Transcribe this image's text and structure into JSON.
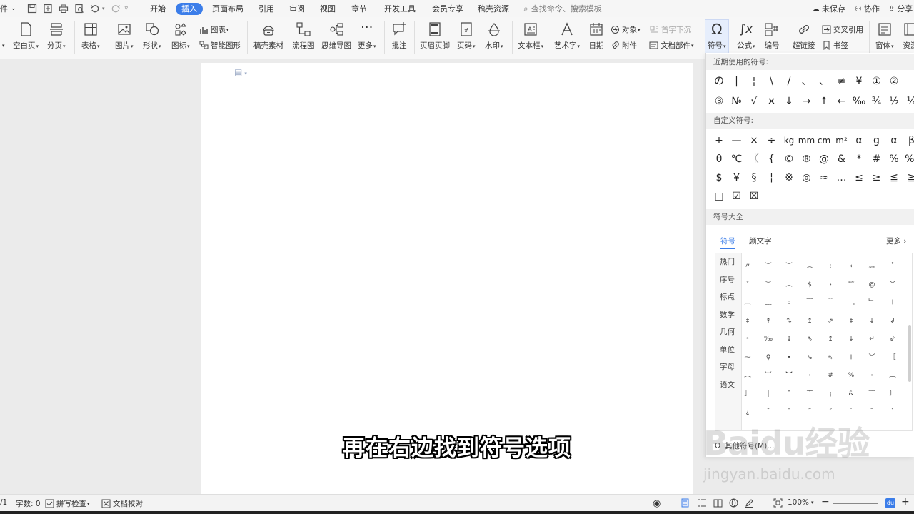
{
  "menubar": {
    "file_fragment": "件",
    "tabs": [
      {
        "label": "开始",
        "active": false
      },
      {
        "label": "插入",
        "active": true
      },
      {
        "label": "页面布局",
        "active": false
      },
      {
        "label": "引用",
        "active": false
      },
      {
        "label": "审阅",
        "active": false
      },
      {
        "label": "视图",
        "active": false
      },
      {
        "label": "章节",
        "active": false
      },
      {
        "label": "开发工具",
        "active": false
      },
      {
        "label": "会员专享",
        "active": false
      },
      {
        "label": "稿壳资源",
        "active": false
      }
    ],
    "search_placeholder": "查找命令、搜索模板",
    "unsaved": "未保存",
    "collaborate": "协作",
    "share": "分享"
  },
  "ribbon": {
    "blank_page": "空白页",
    "page_break": "分页",
    "table": "表格",
    "picture": "图片",
    "shape": "形状",
    "icon": "图标",
    "chart": "图表",
    "smart_art": "智能图形",
    "gaoke_material": "稿壳素材",
    "flowchart": "流程图",
    "mindmap": "思维导图",
    "more": "更多",
    "comment": "批注",
    "header_footer": "页眉页脚",
    "page_number": "页码",
    "watermark": "水印",
    "textbox": "文本框",
    "wordart": "艺术字",
    "date": "日期",
    "object": "对象",
    "attachment": "附件",
    "drop_cap": "首字下沉",
    "doc_parts": "文档部件",
    "symbol": "符号",
    "formula": "公式",
    "numbering": "编号",
    "cross_ref": "交叉引用",
    "hyperlink": "超链接",
    "bookmark": "书签",
    "font_style": "窗体",
    "resources": "资源"
  },
  "panel": {
    "recent_title": "近期使用的符号:",
    "recent_symbols": [
      "の",
      "|",
      "¦",
      "\\",
      "/",
      "、",
      "、",
      "≠",
      "¥",
      "①",
      "②",
      "③",
      "№",
      "√",
      "×",
      "↓",
      "→",
      "↑",
      "←",
      "‰",
      "¾",
      "½",
      "¼"
    ],
    "custom_title": "自定义符号:",
    "custom_symbols": [
      "+",
      "—",
      "×",
      "÷",
      "kg",
      "mm",
      "cm",
      "m²",
      "α",
      "g",
      "α",
      "β",
      "θ",
      "℃",
      "〖",
      "{",
      "©",
      "®",
      "@",
      "&",
      "*",
      "#",
      "%",
      "‰",
      "$",
      "￥",
      "§",
      "¦",
      "※",
      "◎",
      "≈",
      "…",
      "≤",
      "≥",
      "≦",
      "≧",
      "□",
      "☑",
      "☒"
    ],
    "all_title": "符号大全",
    "tab_symbol": "符号",
    "tab_kaomoji": "颜文字",
    "more_link": "更多",
    "categories": [
      "热门",
      "序号",
      "标点",
      "数学",
      "几何",
      "单位",
      "字母",
      "语文"
    ],
    "grid_symbols": [
      "〃",
      "︶",
      "︶",
      "︵",
      ";",
      "‹",
      "︽",
      "˚",
      "˚",
      "︶",
      "︵",
      "$",
      "›",
      "︾",
      "@",
      "﹀",
      "︹",
      "﹏",
      ":",
      "﹋",
      "﹊",
      "﹁",
      "﹂",
      "†",
      "‡",
      "↟",
      "⇅",
      "↥",
      "⇗",
      "‡",
      "↓",
      "↲",
      "◦",
      "‰",
      "↧",
      "⇖",
      "↥",
      "↓",
      "↵",
      "⇙",
      "⁓",
      "♀",
      "•",
      "⇘",
      "⇖",
      "‡",
      "﹀",
      "〚",
      "︻",
      "︺",
      "︼",
      "·",
      "#",
      "%",
      "·",
      "︷",
      "〛",
      "|",
      "ˇ",
      "︸",
      "¡",
      "&",
      "﹌",
      "〕",
      "¿",
      "˘",
      "ˉ",
      "˜",
      "˝",
      "˙",
      "¨",
      "`"
    ],
    "other_symbols": "其他符号(M)..."
  },
  "status": {
    "page": "/1",
    "word_count": "字数: 0",
    "spell_check": "拼写检查",
    "doc_proof": "文档校对",
    "zoom": "100%"
  },
  "subtitle": "再在右边找到符号选项",
  "watermark": {
    "logo": "Baidu经验",
    "url": "jingyan.baidu.com"
  },
  "colors": {
    "accent": "#3b7de9",
    "page_bg": "#ffffff",
    "workspace_bg": "#ebebeb"
  }
}
